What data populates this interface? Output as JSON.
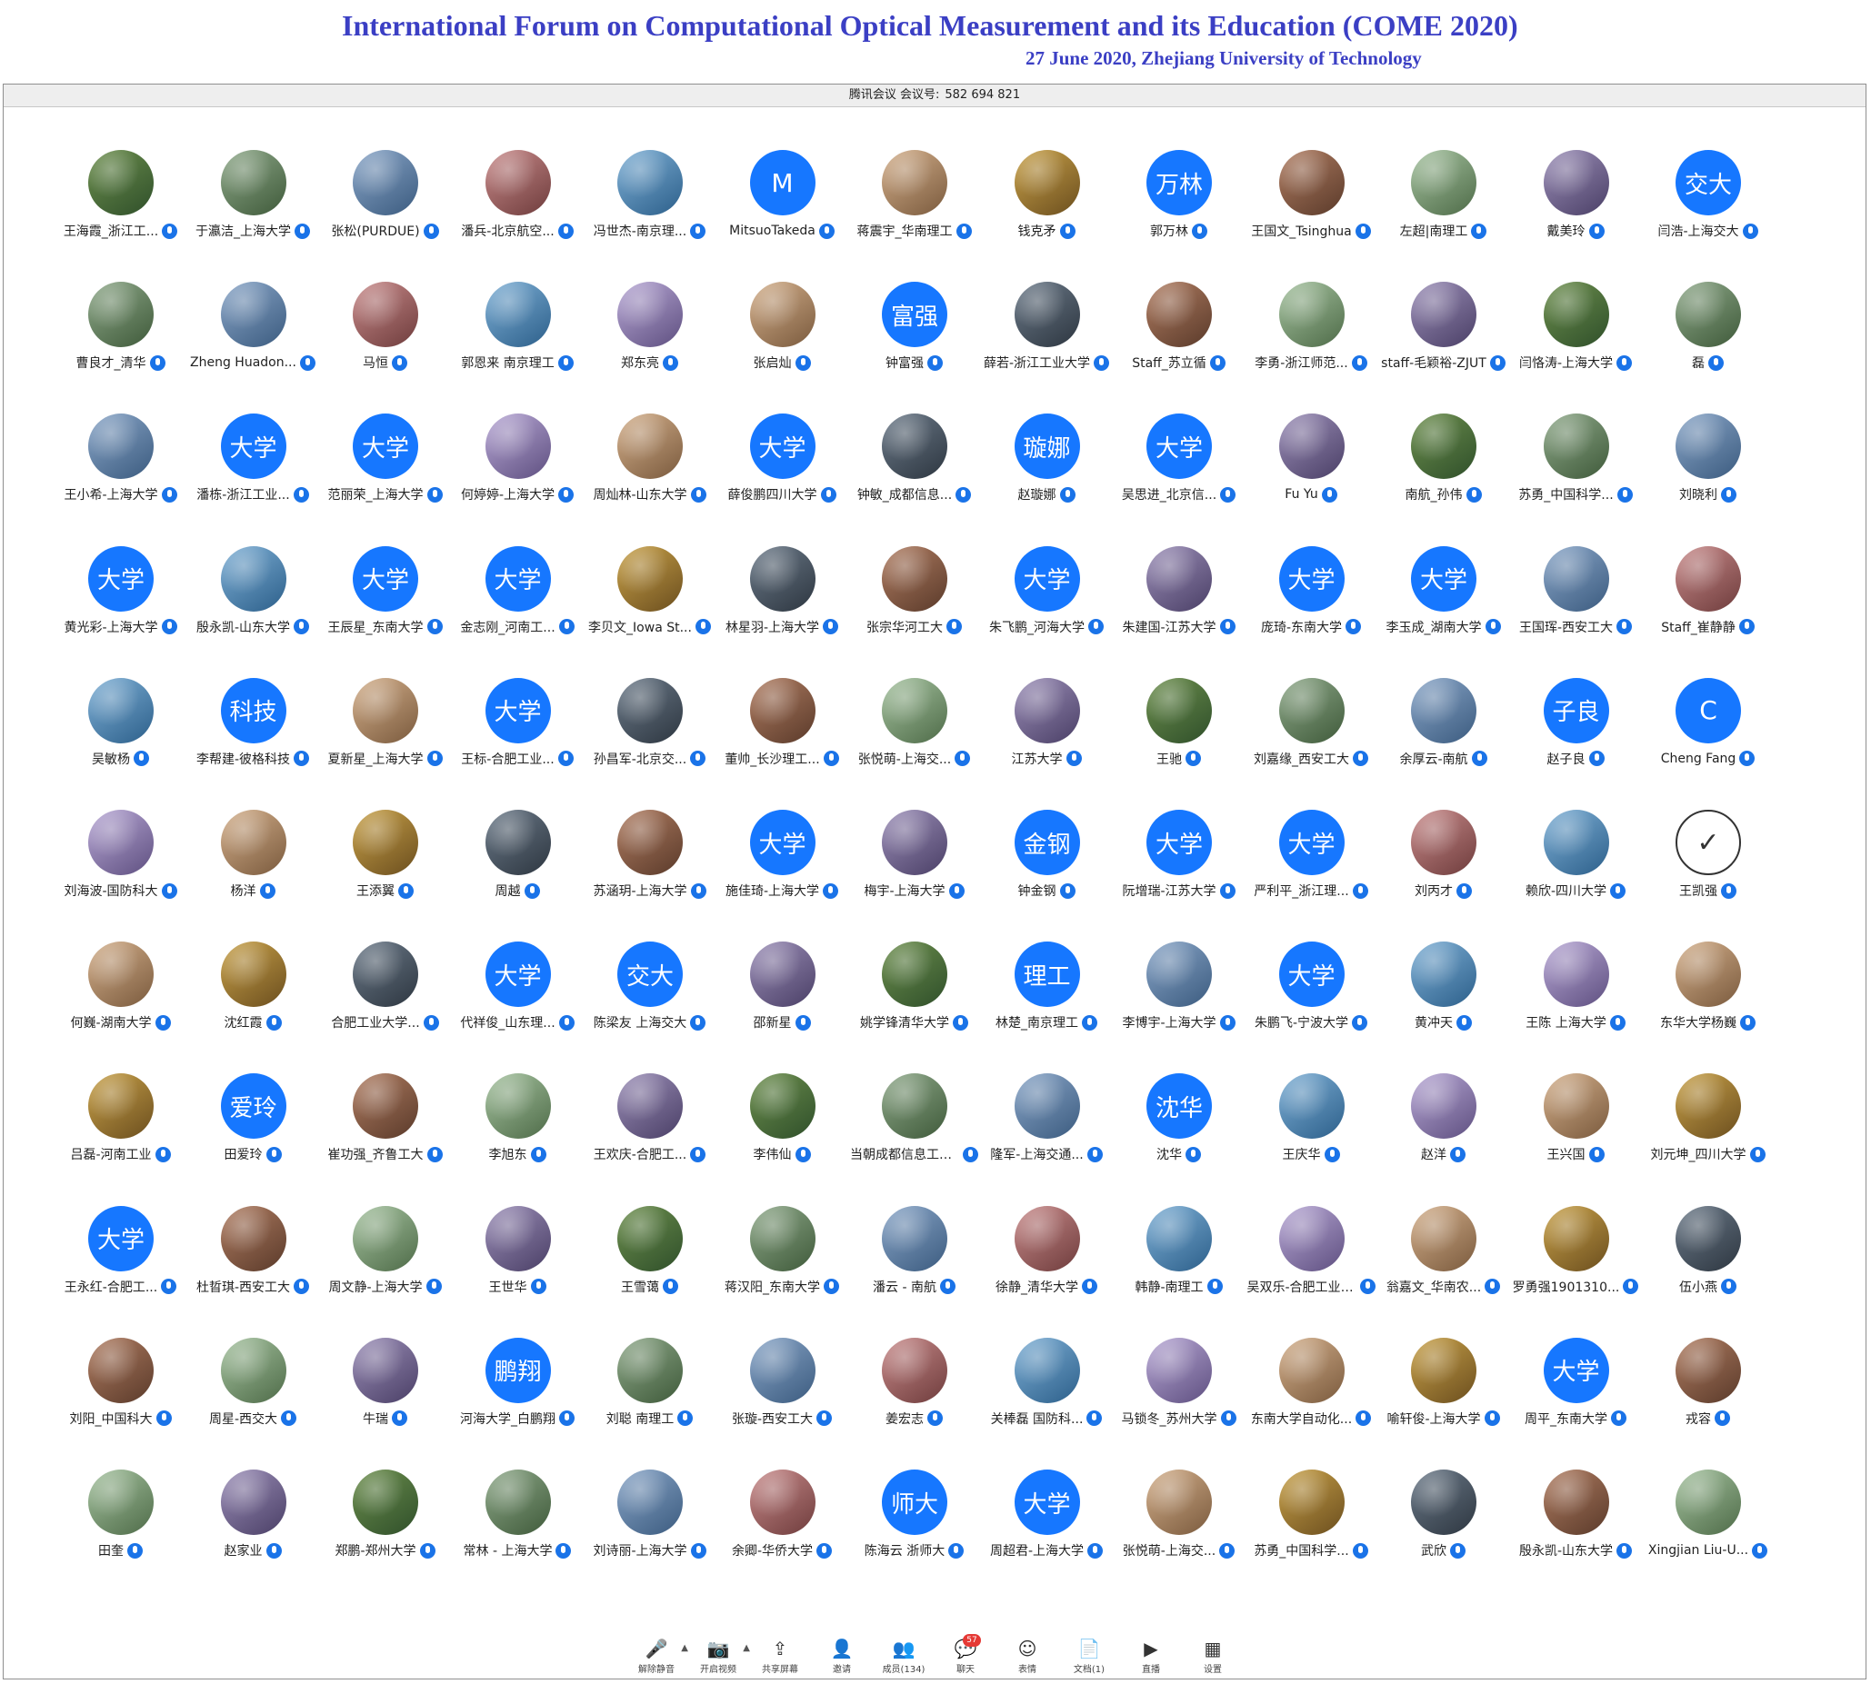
{
  "header": {
    "title": "International Forum on Computational Optical Measurement and its Education (COME 2020)",
    "subtitle": "27 June 2020, Zhejiang University of Technology"
  },
  "meeting_info": {
    "label": "腾讯会议 会议号:",
    "id": "582 694 821"
  },
  "colors": {
    "accent": "#1677ff",
    "title": "#3b3fc4",
    "mic": "#1a73e8",
    "badge": "#e53935"
  },
  "participants": [
    {
      "name": "王海霞_浙江工...",
      "avatar": "photo"
    },
    {
      "name": "于瀛洁_上海大学",
      "avatar": "photo"
    },
    {
      "name": "张松(PURDUE)",
      "avatar": "photo"
    },
    {
      "name": "潘兵-北京航空...",
      "avatar": "photo"
    },
    {
      "name": "冯世杰-南京理...",
      "avatar": "photo"
    },
    {
      "name": "MitsuoTakeda",
      "avatar": "M"
    },
    {
      "name": "蒋震宇_华南理工",
      "avatar": "photo"
    },
    {
      "name": "钱克矛",
      "avatar": "photo"
    },
    {
      "name": "郭万林",
      "avatar": "万林"
    },
    {
      "name": "王国文_Tsinghua",
      "avatar": "photo"
    },
    {
      "name": "左超|南理工",
      "avatar": "photo"
    },
    {
      "name": "戴美玲",
      "avatar": "photo"
    },
    {
      "name": "闫浩-上海交大",
      "avatar": "交大"
    },
    {
      "name": "曹良才_清华",
      "avatar": "photo"
    },
    {
      "name": "Zheng Huadon...",
      "avatar": "photo"
    },
    {
      "name": "马恒",
      "avatar": "photo"
    },
    {
      "name": "郭恩来 南京理工",
      "avatar": "photo"
    },
    {
      "name": "郑东亮",
      "avatar": "photo"
    },
    {
      "name": "张启灿",
      "avatar": "photo"
    },
    {
      "name": "钟富强",
      "avatar": "富强"
    },
    {
      "name": "薛若-浙江工业大学",
      "avatar": "photo"
    },
    {
      "name": "Staff_苏立循",
      "avatar": "photo"
    },
    {
      "name": "李勇-浙江师范...",
      "avatar": "photo"
    },
    {
      "name": "staff-毛颖裕-ZJUT",
      "avatar": "photo"
    },
    {
      "name": "闫恪涛-上海大学",
      "avatar": "photo"
    },
    {
      "name": "磊",
      "avatar": "photo"
    },
    {
      "name": "王小希-上海大学",
      "avatar": "photo"
    },
    {
      "name": "潘栋-浙江工业...",
      "avatar": "大学"
    },
    {
      "name": "范丽荣_上海大学",
      "avatar": "大学"
    },
    {
      "name": "何婷婷-上海大学",
      "avatar": "photo"
    },
    {
      "name": "周灿林-山东大学",
      "avatar": "photo"
    },
    {
      "name": "薛俊鹏四川大学",
      "avatar": "大学"
    },
    {
      "name": "钟敏_成都信息...",
      "avatar": "photo"
    },
    {
      "name": "赵璇娜",
      "avatar": "璇娜"
    },
    {
      "name": "吴思进_北京信...",
      "avatar": "大学"
    },
    {
      "name": "Fu Yu",
      "avatar": "photo"
    },
    {
      "name": "南航_孙伟",
      "avatar": "photo"
    },
    {
      "name": "苏勇_中国科学...",
      "avatar": "photo"
    },
    {
      "name": "刘晓利",
      "avatar": "photo"
    },
    {
      "name": "黄光彩-上海大学",
      "avatar": "大学"
    },
    {
      "name": "殷永凯-山东大学",
      "avatar": "photo"
    },
    {
      "name": "王辰星_东南大学",
      "avatar": "大学"
    },
    {
      "name": "金志刚_河南工...",
      "avatar": "大学"
    },
    {
      "name": "李贝文_Iowa St...",
      "avatar": "photo"
    },
    {
      "name": "林星羽-上海大学",
      "avatar": "photo"
    },
    {
      "name": "张宗华河工大",
      "avatar": "photo"
    },
    {
      "name": "朱飞鹏_河海大学",
      "avatar": "大学"
    },
    {
      "name": "朱建国-江苏大学",
      "avatar": "photo"
    },
    {
      "name": "庞琦-东南大学",
      "avatar": "大学"
    },
    {
      "name": "李玉成_湖南大学",
      "avatar": "大学"
    },
    {
      "name": "王国珲-西安工大",
      "avatar": "photo"
    },
    {
      "name": "Staff_崔静静",
      "avatar": "photo"
    },
    {
      "name": "吴敏杨",
      "avatar": "photo"
    },
    {
      "name": "李帮建-彼格科技",
      "avatar": "科技"
    },
    {
      "name": "夏新星_上海大学",
      "avatar": "photo"
    },
    {
      "name": "王标-合肥工业...",
      "avatar": "大学"
    },
    {
      "name": "孙昌军-北京交...",
      "avatar": "photo"
    },
    {
      "name": "董帅_长沙理工...",
      "avatar": "photo"
    },
    {
      "name": "张悦萌-上海交...",
      "avatar": "photo"
    },
    {
      "name": "江苏大学",
      "avatar": "photo"
    },
    {
      "name": "王驰",
      "avatar": "photo"
    },
    {
      "name": "刘嘉缘_西安工大",
      "avatar": "photo"
    },
    {
      "name": "余厚云-南航",
      "avatar": "photo"
    },
    {
      "name": "赵子良",
      "avatar": "子良"
    },
    {
      "name": "Cheng Fang",
      "avatar": "C"
    },
    {
      "name": "刘海波-国防科大",
      "avatar": "photo"
    },
    {
      "name": "杨洋",
      "avatar": "photo"
    },
    {
      "name": "王添翼",
      "avatar": "photo"
    },
    {
      "name": "周越",
      "avatar": "photo"
    },
    {
      "name": "苏涵玥-上海大学",
      "avatar": "photo"
    },
    {
      "name": "施佳琦-上海大学",
      "avatar": "大学"
    },
    {
      "name": "梅宇-上海大学",
      "avatar": "photo"
    },
    {
      "name": "钟金钢",
      "avatar": "金钢"
    },
    {
      "name": "阮增瑞-江苏大学",
      "avatar": "大学"
    },
    {
      "name": "严利平_浙江理...",
      "avatar": "大学"
    },
    {
      "name": "刘丙才",
      "avatar": "photo"
    },
    {
      "name": "赖欣-四川大学",
      "avatar": "photo"
    },
    {
      "name": "王凯强",
      "avatar": "check"
    },
    {
      "name": "何巍-湖南大学",
      "avatar": "photo"
    },
    {
      "name": "沈红霞",
      "avatar": "photo"
    },
    {
      "name": "合肥工业大学...",
      "avatar": "photo"
    },
    {
      "name": "代祥俊_山东理...",
      "avatar": "大学"
    },
    {
      "name": "陈梁友 上海交大",
      "avatar": "交大"
    },
    {
      "name": "邵新星",
      "avatar": "photo"
    },
    {
      "name": "姚学锋清华大学",
      "avatar": "photo"
    },
    {
      "name": "林楚_南京理工",
      "avatar": "理工"
    },
    {
      "name": "李博宇-上海大学",
      "avatar": "photo"
    },
    {
      "name": "朱鹏飞-宁波大学",
      "avatar": "大学"
    },
    {
      "name": "黄冲天",
      "avatar": "photo"
    },
    {
      "name": "王陈 上海大学",
      "avatar": "photo"
    },
    {
      "name": "东华大学杨巍",
      "avatar": "photo"
    },
    {
      "name": "吕磊-河南工业",
      "avatar": "photo"
    },
    {
      "name": "田爱玲",
      "avatar": "爱玲"
    },
    {
      "name": "崔功强_齐鲁工大",
      "avatar": "photo"
    },
    {
      "name": "李旭东",
      "avatar": "photo"
    },
    {
      "name": "王欢庆-合肥工...",
      "avatar": "photo"
    },
    {
      "name": "李伟仙",
      "avatar": "photo"
    },
    {
      "name": "当朝成都信息工程...",
      "avatar": "photo"
    },
    {
      "name": "隆军-上海交通...",
      "avatar": "photo"
    },
    {
      "name": "沈华",
      "avatar": "沈华"
    },
    {
      "name": "王庆华",
      "avatar": "photo"
    },
    {
      "name": "赵洋",
      "avatar": "photo"
    },
    {
      "name": "王兴国",
      "avatar": "photo"
    },
    {
      "name": "刘元坤_四川大学",
      "avatar": "photo"
    },
    {
      "name": "王永红-合肥工...",
      "avatar": "大学"
    },
    {
      "name": "杜晢琪-西安工大",
      "avatar": "photo"
    },
    {
      "name": "周文静-上海大学",
      "avatar": "photo"
    },
    {
      "name": "王世华",
      "avatar": "photo"
    },
    {
      "name": "王雪蔼",
      "avatar": "photo"
    },
    {
      "name": "蒋汉阳_东南大学",
      "avatar": "photo"
    },
    {
      "name": "潘云 - 南航",
      "avatar": "photo"
    },
    {
      "name": "徐静_清华大学",
      "avatar": "photo"
    },
    {
      "name": "韩静-南理工",
      "avatar": "photo"
    },
    {
      "name": "吴双乐-合肥工业大学",
      "avatar": "photo"
    },
    {
      "name": "翁嘉文_华南农...",
      "avatar": "photo"
    },
    {
      "name": "罗勇强1901310...",
      "avatar": "photo"
    },
    {
      "name": "伍小燕",
      "avatar": "photo"
    },
    {
      "name": "刘阳_中国科大",
      "avatar": "photo"
    },
    {
      "name": "周星-西交大",
      "avatar": "photo"
    },
    {
      "name": "牛瑞",
      "avatar": "photo"
    },
    {
      "name": "河海大学_白鹏翔",
      "avatar": "鹏翔"
    },
    {
      "name": "刘聪 南理工",
      "avatar": "photo"
    },
    {
      "name": "张璇-西安工大",
      "avatar": "photo"
    },
    {
      "name": "姜宏志",
      "avatar": "photo"
    },
    {
      "name": "关棒磊 国防科...",
      "avatar": "photo"
    },
    {
      "name": "马锁冬_苏州大学",
      "avatar": "photo"
    },
    {
      "name": "东南大学自动化...",
      "avatar": "photo"
    },
    {
      "name": "喻轩俊-上海大学",
      "avatar": "photo"
    },
    {
      "name": "周平_东南大学",
      "avatar": "大学"
    },
    {
      "name": "戎容",
      "avatar": "photo"
    },
    {
      "name": "田奎",
      "avatar": "photo"
    },
    {
      "name": "赵家业",
      "avatar": "photo"
    },
    {
      "name": "郑鹏-郑州大学",
      "avatar": "photo"
    },
    {
      "name": "常林 - 上海大学",
      "avatar": "photo"
    },
    {
      "name": "刘诗丽-上海大学",
      "avatar": "photo"
    },
    {
      "name": "余卿-华侨大学",
      "avatar": "photo"
    },
    {
      "name": "陈海云 浙师大",
      "avatar": "师大"
    },
    {
      "name": "周超君-上海大学",
      "avatar": "大学"
    },
    {
      "name": "张悦萌-上海交...",
      "avatar": "photo"
    },
    {
      "name": "苏勇_中国科学...",
      "avatar": "photo"
    },
    {
      "name": "武欣",
      "avatar": "photo"
    },
    {
      "name": "殷永凯-山东大学",
      "avatar": "photo"
    },
    {
      "name": "Xingjian Liu-U...",
      "avatar": "photo"
    }
  ],
  "toolbar": [
    {
      "id": "unmute",
      "label": "解除静音",
      "icon": "mic-off-icon",
      "glyph": "🎤",
      "caret": true
    },
    {
      "id": "video",
      "label": "开启视频",
      "icon": "camera-off-icon",
      "glyph": "📷",
      "caret": true
    },
    {
      "id": "share",
      "label": "共享屏幕",
      "icon": "share-screen-icon",
      "glyph": "⇪"
    },
    {
      "id": "invite",
      "label": "邀请",
      "icon": "invite-icon",
      "glyph": "👤"
    },
    {
      "id": "members",
      "label": "成员(134)",
      "icon": "members-icon",
      "glyph": "👥"
    },
    {
      "id": "chat",
      "label": "聊天",
      "icon": "chat-icon",
      "glyph": "💬",
      "badge": "57"
    },
    {
      "id": "emoji",
      "label": "表情",
      "icon": "emoji-icon",
      "glyph": "☺"
    },
    {
      "id": "docs",
      "label": "文档(1)",
      "icon": "document-icon",
      "glyph": "📄"
    },
    {
      "id": "live",
      "label": "直播",
      "icon": "live-icon",
      "glyph": "▶"
    },
    {
      "id": "settings",
      "label": "设置",
      "icon": "settings-icon",
      "glyph": "▦"
    }
  ]
}
